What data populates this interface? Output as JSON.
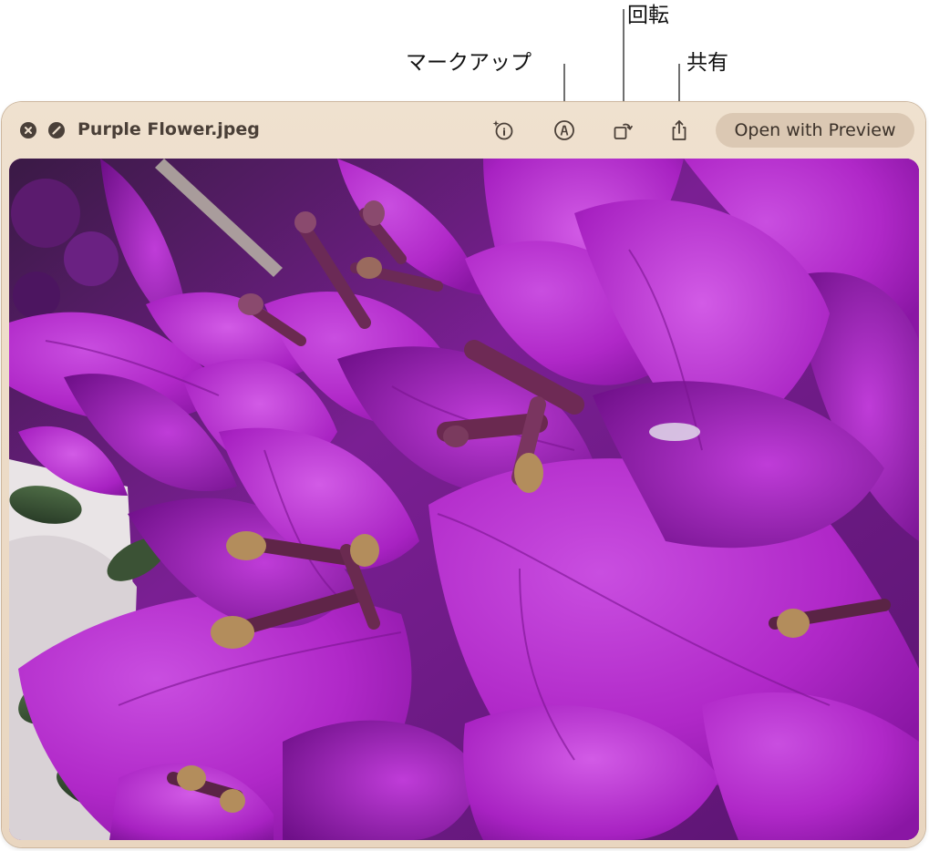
{
  "callouts": {
    "markup": "マークアップ",
    "rotate": "回転",
    "share": "共有"
  },
  "window": {
    "title": "Purple Flower.jpeg",
    "open_with_preview": "Open with Preview",
    "icons": {
      "close": "close-icon",
      "fullscreen": "fullscreen-icon",
      "info": "info-sparkle-icon",
      "markup": "markup-pen-icon",
      "rotate": "rotate-icon",
      "share": "share-icon"
    }
  },
  "photo": {
    "subject": "purple-bougainvillea"
  },
  "colors": {
    "window_tint": "#eddcc8",
    "button_fill": "#dbc8b3",
    "icon": "#4a3f37",
    "petal": "#b226c9"
  }
}
